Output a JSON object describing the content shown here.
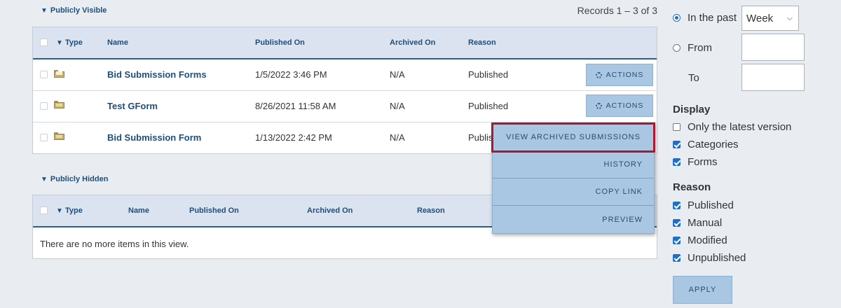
{
  "visible_section": {
    "title": "Publicly Visible",
    "records": "Records 1 – 3 of 3",
    "columns": {
      "type": "Type",
      "name": "Name",
      "published_on": "Published On",
      "archived_on": "Archived On",
      "reason": "Reason"
    },
    "rows": [
      {
        "name": "Bid Submission Forms",
        "published_on": "1/5/2022 3:46 PM",
        "archived_on": "N/A",
        "reason": "Published",
        "action": "ACTIONS",
        "icon": "folder-open-icon"
      },
      {
        "name": "Test GForm",
        "published_on": "8/26/2021 11:58 AM",
        "archived_on": "N/A",
        "reason": "Published",
        "action": "ACTIONS",
        "icon": "form-icon"
      },
      {
        "name": "Bid Submission Form",
        "published_on": "1/13/2022 2:42 PM",
        "archived_on": "N/A",
        "reason": "Publis",
        "icon": "form-icon"
      }
    ]
  },
  "actions_menu": {
    "items": [
      "VIEW ARCHIVED SUBMISSIONS",
      "HISTORY",
      "COPY LINK",
      "PREVIEW"
    ],
    "highlight_color": "#b0142e"
  },
  "hidden_section": {
    "title": "Publicly Hidden",
    "columns": {
      "type": "Type",
      "name": "Name",
      "published_on": "Published On",
      "archived_on": "Archived On",
      "reason": "Reason"
    },
    "empty_message": "There are no more items in this view."
  },
  "filters": {
    "in_the_past_label": "In the past",
    "period_selected": "Week",
    "from_label": "From",
    "to_label": "To",
    "display_heading": "Display",
    "display_options": [
      {
        "label": "Only the latest version",
        "checked": false
      },
      {
        "label": "Categories",
        "checked": true
      },
      {
        "label": "Forms",
        "checked": true
      }
    ],
    "reason_heading": "Reason",
    "reason_options": [
      {
        "label": "Published",
        "checked": true
      },
      {
        "label": "Manual",
        "checked": true
      },
      {
        "label": "Modified",
        "checked": true
      },
      {
        "label": "Unpublished",
        "checked": true
      }
    ],
    "apply_label": "APPLY"
  },
  "colors": {
    "header_bg": "#dae3ef",
    "accent": "#1f4e7a",
    "button_bg": "#a9c6e3",
    "checkbox_blue": "#1f6fc5"
  }
}
